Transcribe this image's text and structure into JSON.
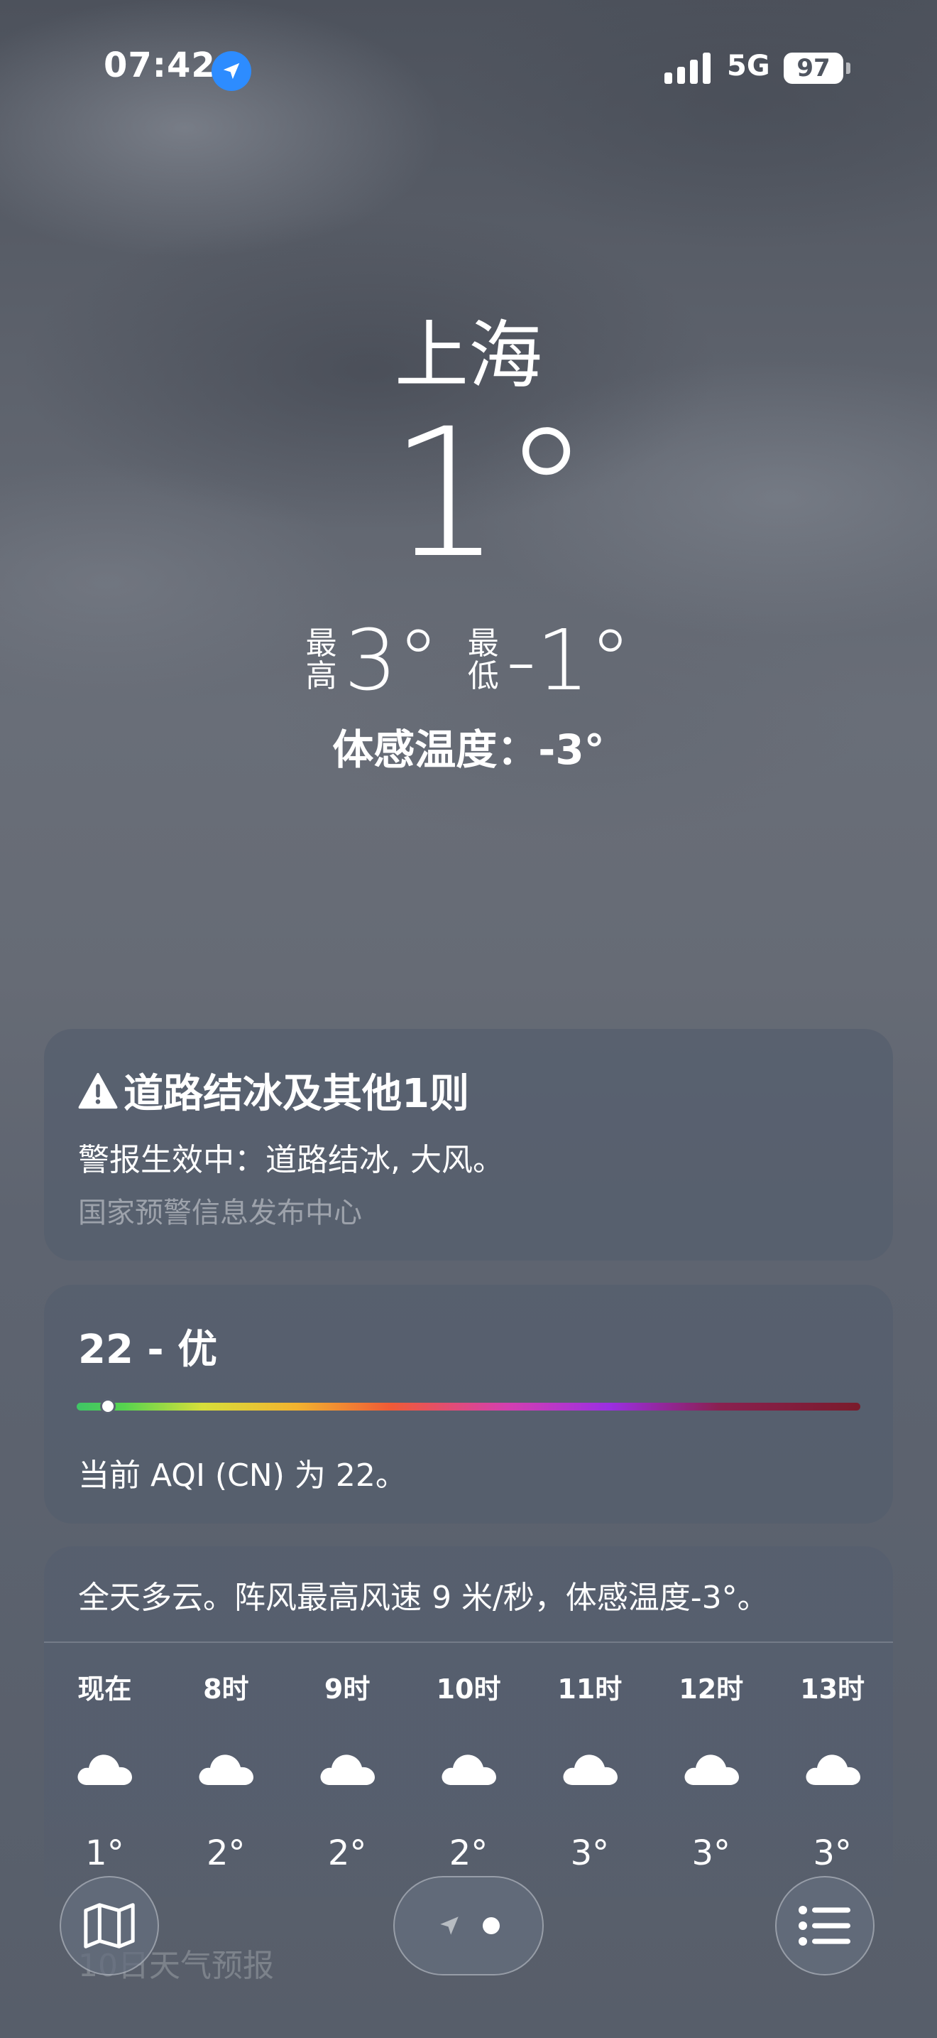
{
  "status_bar": {
    "time": "07:42",
    "network": "5G",
    "battery": "97",
    "location_icon": "location-arrow-icon",
    "signal_icon": "signal-bars-icon"
  },
  "current": {
    "city": "上海",
    "temperature": "1°",
    "high_label": [
      "最",
      "高"
    ],
    "high": "3°",
    "low_label": [
      "最",
      "低"
    ],
    "low": "-1°",
    "feels_like": "体感温度：-3°"
  },
  "alert": {
    "icon": "warning-icon",
    "title": "道路结冰及其他1则",
    "body": "警报生效中：道路结冰, 大风。",
    "source": "国家预警信息发布中心"
  },
  "aqi": {
    "value_text": "22 - 优",
    "level_fraction": 0.04,
    "description": "当前 AQI (CN) 为 22。"
  },
  "hourly": {
    "summary": "全天多云。阵风最高风速 9 米/秒，体感温度-3°。",
    "hours": [
      {
        "label": "现在",
        "icon": "cloud-icon",
        "temp": "1°"
      },
      {
        "label": "8时",
        "icon": "cloud-icon",
        "temp": "2°"
      },
      {
        "label": "9时",
        "icon": "cloud-icon",
        "temp": "2°"
      },
      {
        "label": "10时",
        "icon": "cloud-icon",
        "temp": "2°"
      },
      {
        "label": "11时",
        "icon": "cloud-icon",
        "temp": "3°"
      },
      {
        "label": "12时",
        "icon": "cloud-icon",
        "temp": "3°"
      },
      {
        "label": "13时",
        "icon": "cloud-icon",
        "temp": "3°"
      }
    ]
  },
  "forecast_link": "10日天气预报",
  "toolbar": {
    "map_icon": "map-icon",
    "location_icon": "location-arrow-icon",
    "list_icon": "list-icon"
  }
}
